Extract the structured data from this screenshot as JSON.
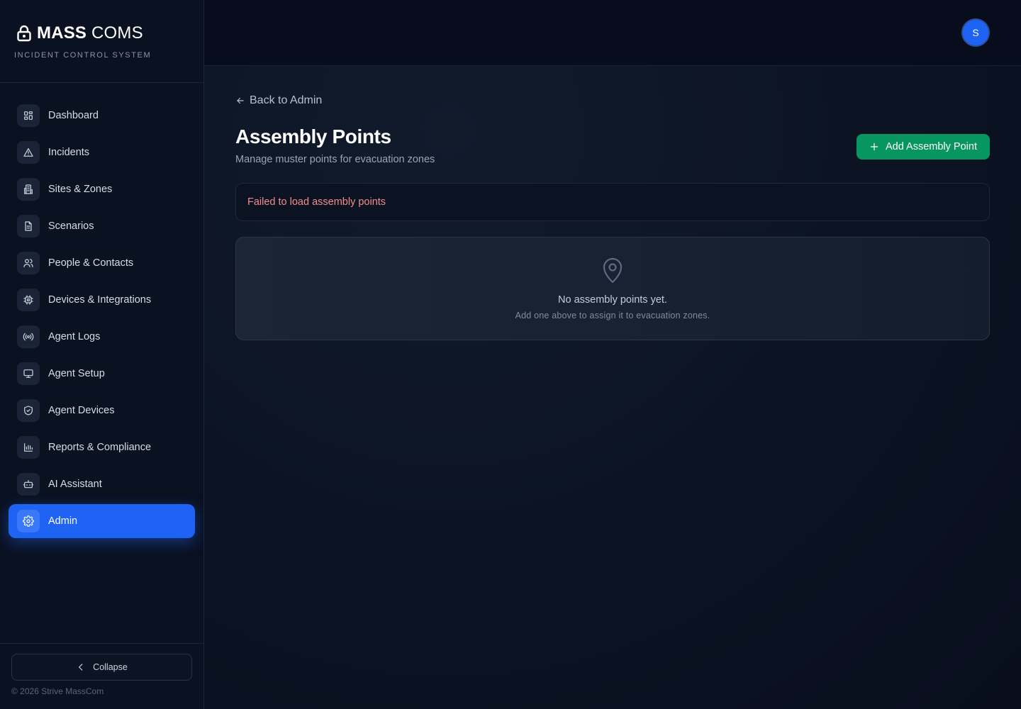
{
  "brand": {
    "name_bold": "MASS",
    "name_light": "COMS",
    "subtitle": "INCIDENT CONTROL SYSTEM"
  },
  "sidebar": {
    "items": [
      {
        "label": "Dashboard",
        "icon": "dashboard-icon",
        "active": false
      },
      {
        "label": "Incidents",
        "icon": "warning-icon",
        "active": false
      },
      {
        "label": "Sites & Zones",
        "icon": "building-icon",
        "active": false
      },
      {
        "label": "Scenarios",
        "icon": "document-icon",
        "active": false
      },
      {
        "label": "People & Contacts",
        "icon": "users-icon",
        "active": false
      },
      {
        "label": "Devices & Integrations",
        "icon": "chip-icon",
        "active": false
      },
      {
        "label": "Agent Logs",
        "icon": "broadcast-icon",
        "active": false
      },
      {
        "label": "Agent Setup",
        "icon": "monitor-icon",
        "active": false
      },
      {
        "label": "Agent Devices",
        "icon": "shield-icon",
        "active": false
      },
      {
        "label": "Reports & Compliance",
        "icon": "bar-chart-icon",
        "active": false
      },
      {
        "label": "AI Assistant",
        "icon": "bot-icon",
        "active": false
      },
      {
        "label": "Admin",
        "icon": "gear-icon",
        "active": true
      }
    ],
    "collapse_label": "Collapse",
    "copyright": "© 2026 Strive MassCom"
  },
  "topbar": {
    "avatar_initial": "S"
  },
  "main": {
    "back_label": "Back to Admin",
    "title": "Assembly Points",
    "subtitle": "Manage muster points for evacuation zones",
    "add_button_label": "Add Assembly Point",
    "error_text": "Failed to load assembly points",
    "empty_title": "No assembly points yet.",
    "empty_text": "Add one above to assign it to evacuation zones."
  },
  "colors": {
    "accent": "#1f63f5",
    "success": "#07965f",
    "error": "#f58b8b",
    "background": "#0b1220"
  }
}
